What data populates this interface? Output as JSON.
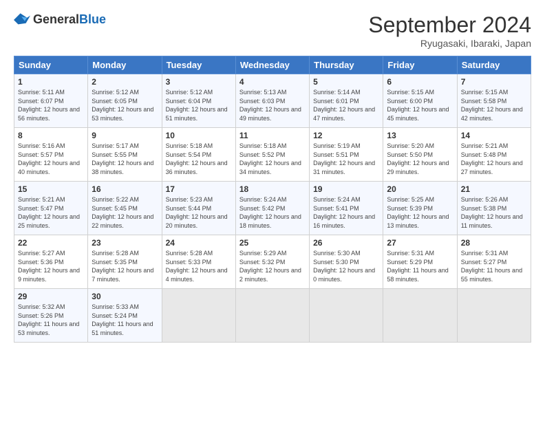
{
  "logo": {
    "general": "General",
    "blue": "Blue"
  },
  "title": "September 2024",
  "subtitle": "Ryugasaki, Ibaraki, Japan",
  "days_of_week": [
    "Sunday",
    "Monday",
    "Tuesday",
    "Wednesday",
    "Thursday",
    "Friday",
    "Saturday"
  ],
  "weeks": [
    [
      {
        "day": "1",
        "sunrise": "5:11 AM",
        "sunset": "6:07 PM",
        "daylight": "12 hours and 56 minutes."
      },
      {
        "day": "2",
        "sunrise": "5:12 AM",
        "sunset": "6:05 PM",
        "daylight": "12 hours and 53 minutes."
      },
      {
        "day": "3",
        "sunrise": "5:12 AM",
        "sunset": "6:04 PM",
        "daylight": "12 hours and 51 minutes."
      },
      {
        "day": "4",
        "sunrise": "5:13 AM",
        "sunset": "6:03 PM",
        "daylight": "12 hours and 49 minutes."
      },
      {
        "day": "5",
        "sunrise": "5:14 AM",
        "sunset": "6:01 PM",
        "daylight": "12 hours and 47 minutes."
      },
      {
        "day": "6",
        "sunrise": "5:15 AM",
        "sunset": "6:00 PM",
        "daylight": "12 hours and 45 minutes."
      },
      {
        "day": "7",
        "sunrise": "5:15 AM",
        "sunset": "5:58 PM",
        "daylight": "12 hours and 42 minutes."
      }
    ],
    [
      {
        "day": "8",
        "sunrise": "5:16 AM",
        "sunset": "5:57 PM",
        "daylight": "12 hours and 40 minutes."
      },
      {
        "day": "9",
        "sunrise": "5:17 AM",
        "sunset": "5:55 PM",
        "daylight": "12 hours and 38 minutes."
      },
      {
        "day": "10",
        "sunrise": "5:18 AM",
        "sunset": "5:54 PM",
        "daylight": "12 hours and 36 minutes."
      },
      {
        "day": "11",
        "sunrise": "5:18 AM",
        "sunset": "5:52 PM",
        "daylight": "12 hours and 34 minutes."
      },
      {
        "day": "12",
        "sunrise": "5:19 AM",
        "sunset": "5:51 PM",
        "daylight": "12 hours and 31 minutes."
      },
      {
        "day": "13",
        "sunrise": "5:20 AM",
        "sunset": "5:50 PM",
        "daylight": "12 hours and 29 minutes."
      },
      {
        "day": "14",
        "sunrise": "5:21 AM",
        "sunset": "5:48 PM",
        "daylight": "12 hours and 27 minutes."
      }
    ],
    [
      {
        "day": "15",
        "sunrise": "5:21 AM",
        "sunset": "5:47 PM",
        "daylight": "12 hours and 25 minutes."
      },
      {
        "day": "16",
        "sunrise": "5:22 AM",
        "sunset": "5:45 PM",
        "daylight": "12 hours and 22 minutes."
      },
      {
        "day": "17",
        "sunrise": "5:23 AM",
        "sunset": "5:44 PM",
        "daylight": "12 hours and 20 minutes."
      },
      {
        "day": "18",
        "sunrise": "5:24 AM",
        "sunset": "5:42 PM",
        "daylight": "12 hours and 18 minutes."
      },
      {
        "day": "19",
        "sunrise": "5:24 AM",
        "sunset": "5:41 PM",
        "daylight": "12 hours and 16 minutes."
      },
      {
        "day": "20",
        "sunrise": "5:25 AM",
        "sunset": "5:39 PM",
        "daylight": "12 hours and 13 minutes."
      },
      {
        "day": "21",
        "sunrise": "5:26 AM",
        "sunset": "5:38 PM",
        "daylight": "12 hours and 11 minutes."
      }
    ],
    [
      {
        "day": "22",
        "sunrise": "5:27 AM",
        "sunset": "5:36 PM",
        "daylight": "12 hours and 9 minutes."
      },
      {
        "day": "23",
        "sunrise": "5:28 AM",
        "sunset": "5:35 PM",
        "daylight": "12 hours and 7 minutes."
      },
      {
        "day": "24",
        "sunrise": "5:28 AM",
        "sunset": "5:33 PM",
        "daylight": "12 hours and 4 minutes."
      },
      {
        "day": "25",
        "sunrise": "5:29 AM",
        "sunset": "5:32 PM",
        "daylight": "12 hours and 2 minutes."
      },
      {
        "day": "26",
        "sunrise": "5:30 AM",
        "sunset": "5:30 PM",
        "daylight": "12 hours and 0 minutes."
      },
      {
        "day": "27",
        "sunrise": "5:31 AM",
        "sunset": "5:29 PM",
        "daylight": "11 hours and 58 minutes."
      },
      {
        "day": "28",
        "sunrise": "5:31 AM",
        "sunset": "5:27 PM",
        "daylight": "11 hours and 55 minutes."
      }
    ],
    [
      {
        "day": "29",
        "sunrise": "5:32 AM",
        "sunset": "5:26 PM",
        "daylight": "11 hours and 53 minutes."
      },
      {
        "day": "30",
        "sunrise": "5:33 AM",
        "sunset": "5:24 PM",
        "daylight": "11 hours and 51 minutes."
      },
      {
        "day": "",
        "sunrise": "",
        "sunset": "",
        "daylight": ""
      },
      {
        "day": "",
        "sunrise": "",
        "sunset": "",
        "daylight": ""
      },
      {
        "day": "",
        "sunrise": "",
        "sunset": "",
        "daylight": ""
      },
      {
        "day": "",
        "sunrise": "",
        "sunset": "",
        "daylight": ""
      },
      {
        "day": "",
        "sunrise": "",
        "sunset": "",
        "daylight": ""
      }
    ]
  ],
  "labels": {
    "sunrise": "Sunrise:",
    "sunset": "Sunset:",
    "daylight": "Daylight:"
  }
}
